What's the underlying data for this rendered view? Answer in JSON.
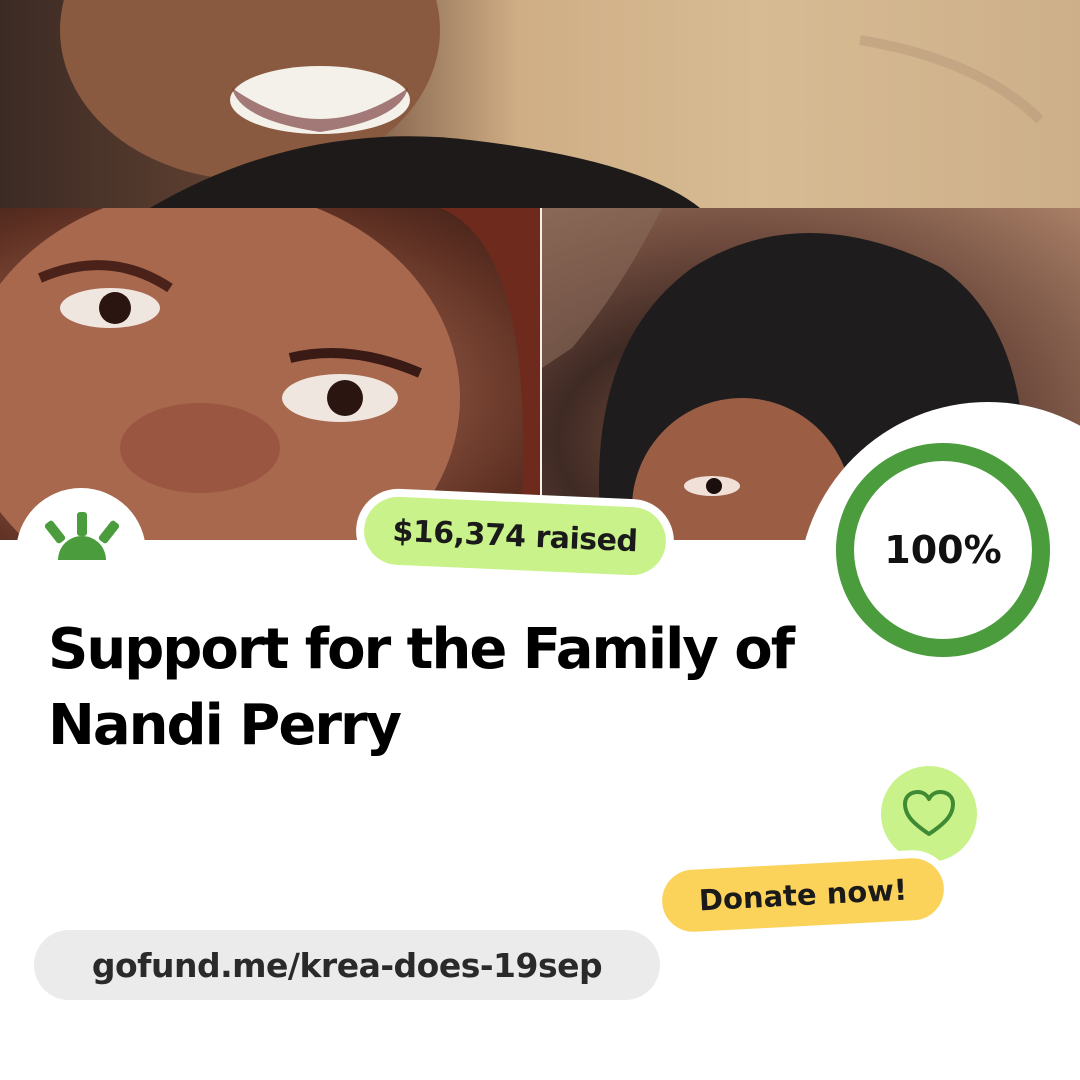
{
  "campaign": {
    "raised_label": "$16,374 raised",
    "progress_label": "100%",
    "progress_fraction": 1.0,
    "title": "Support for the Family of Nandi Perry",
    "donate_label": "Donate now!",
    "url": "gofund.me/krea-does-19sep"
  },
  "icons": {
    "logo": "gofundme-sunrise-icon",
    "heart": "heart-icon"
  },
  "colors": {
    "brand_green": "#4a9c3c",
    "lime": "#c9f28b",
    "donate_yellow": "#fbd35b",
    "url_pill": "#ebebeb"
  }
}
